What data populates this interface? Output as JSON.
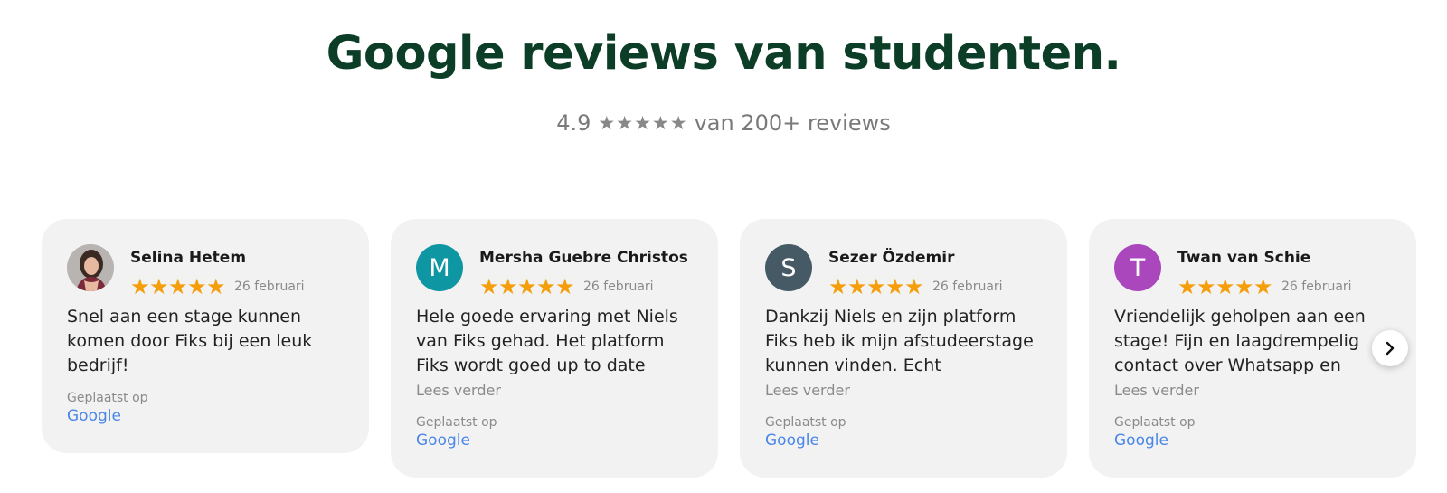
{
  "header": {
    "title": "Google reviews van studenten.",
    "rating_value": "4.9",
    "rating_stars": [
      "★",
      "★",
      "★",
      "★",
      "★"
    ],
    "rating_suffix": "van 200+ reviews"
  },
  "colors": {
    "heading": "#0b3d27",
    "star": "#f59e0b",
    "card_bg": "#f2f2f2",
    "link": "#4a86e8"
  },
  "reviews": [
    {
      "name": "Selina Hetem",
      "avatar": "photo",
      "avatar_letter": "",
      "avatar_color": "#c9c2bd",
      "stars": [
        "★",
        "★",
        "★",
        "★",
        "★"
      ],
      "date": "26 februari",
      "text": "Snel aan een stage kunnen komen door Fiks bij een leuk bedrijf!",
      "read_more": "",
      "posted_label": "Geplaatst op",
      "source": "Google"
    },
    {
      "name": "Mersha Guebre Christos",
      "avatar": "letter",
      "avatar_letter": "M",
      "avatar_color": "#0e97a3",
      "stars": [
        "★",
        "★",
        "★",
        "★",
        "★"
      ],
      "date": "26 februari",
      "text": "Hele goede ervaring met Niels van Fiks gehad. Het platform Fiks wordt goed up to date",
      "read_more": "Lees verder",
      "posted_label": "Geplaatst op",
      "source": "Google"
    },
    {
      "name": "Sezer Özdemir",
      "avatar": "letter",
      "avatar_letter": "S",
      "avatar_color": "#455a64",
      "stars": [
        "★",
        "★",
        "★",
        "★",
        "★"
      ],
      "date": "26 februari",
      "text": "Dankzij Niels en zijn platform Fiks heb ik mijn afstudeerstage kunnen vinden. Echt",
      "read_more": "Lees verder",
      "posted_label": "Geplaatst op",
      "source": "Google"
    },
    {
      "name": "Twan van Schie",
      "avatar": "letter",
      "avatar_letter": "T",
      "avatar_color": "#ab47bc",
      "stars": [
        "★",
        "★",
        "★",
        "★",
        "★"
      ],
      "date": "26 februari",
      "text": "Vriendelijk geholpen aan een stage! Fijn en laagdrempelig contact over Whatsapp en",
      "read_more": "Lees verder",
      "posted_label": "Geplaatst op",
      "source": "Google"
    }
  ],
  "carousel": {
    "next_icon": "chevron-right-icon"
  }
}
